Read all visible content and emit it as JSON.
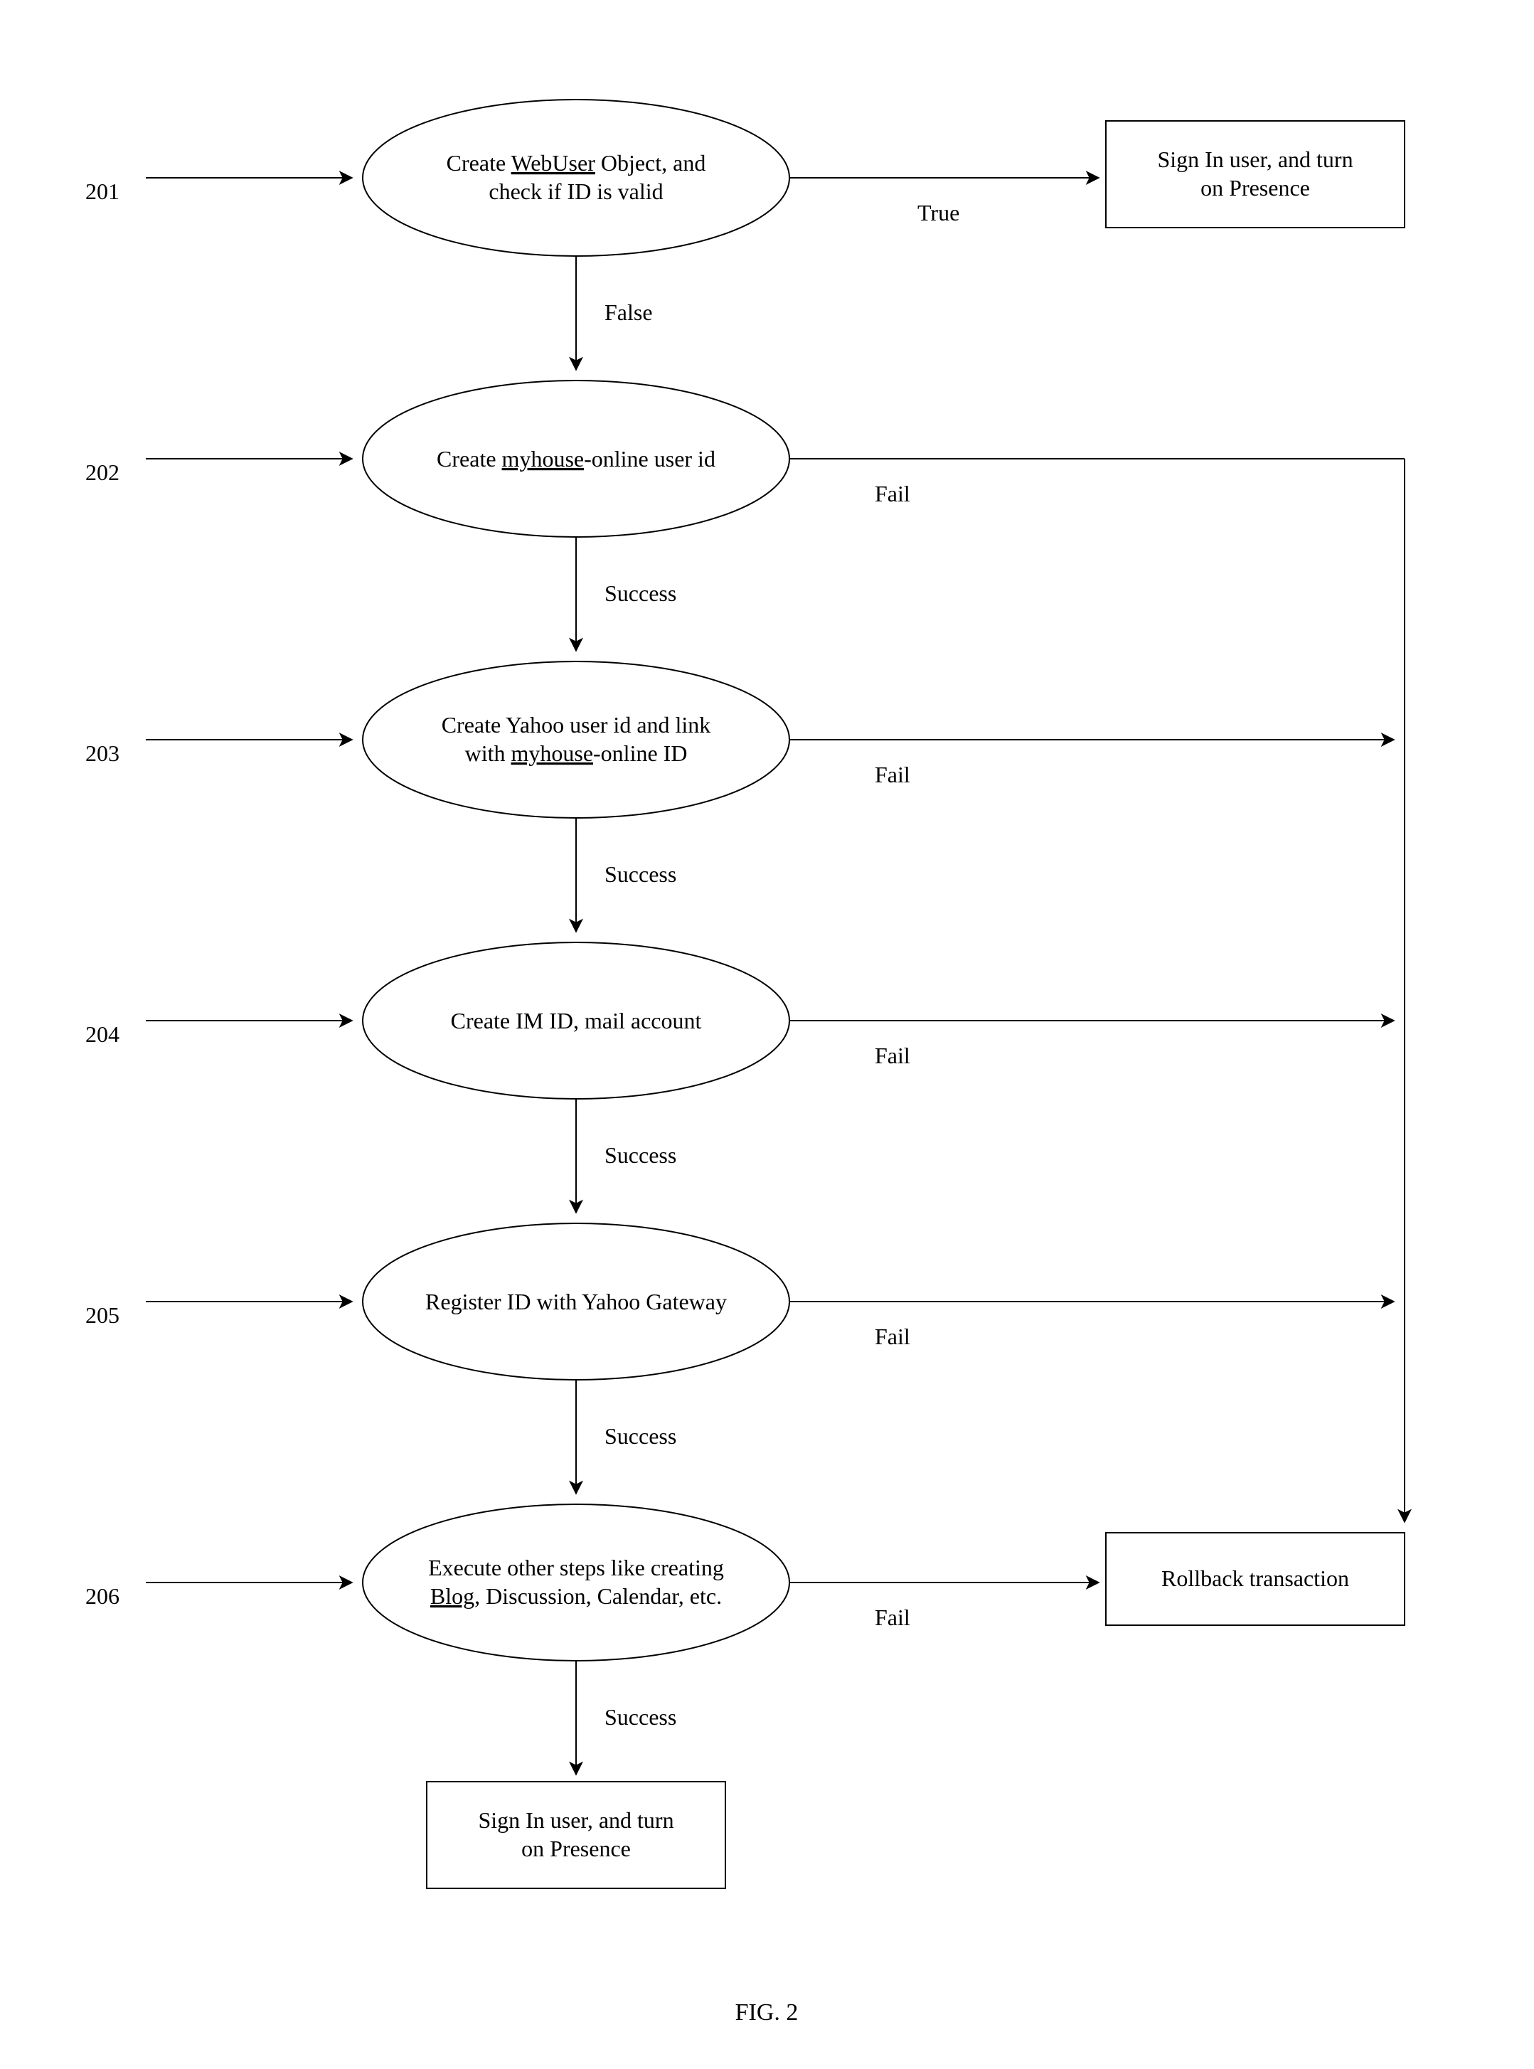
{
  "figure": {
    "caption": "FIG. 2"
  },
  "refs": {
    "r201": "201",
    "r202": "202",
    "r203": "203",
    "r204": "204",
    "r205": "205",
    "r206": "206"
  },
  "nodes": {
    "n1": {
      "l1a": "Create ",
      "l1b": "WebUser",
      "l1c": " Object, and",
      "l2": "check if ID is valid"
    },
    "n2": {
      "l1a": "Create ",
      "l1b": "myhouse",
      "l1c": "-online user id"
    },
    "n3": {
      "l1": "Create Yahoo user id and link",
      "l2a": "with ",
      "l2b": "myhouse",
      "l2c": "-online ID"
    },
    "n4": {
      "l1": "Create IM ID, mail account"
    },
    "n5": {
      "l1": "Register ID with Yahoo Gateway"
    },
    "n6": {
      "l1": "Execute other steps like creating",
      "l2a": "Blog",
      "l2b": ", Discussion, Calendar, etc."
    },
    "signin": {
      "l1": "Sign In user, and turn",
      "l2": "on Presence"
    },
    "rollback": {
      "l1": "Rollback transaction"
    }
  },
  "labels": {
    "true": "True",
    "false": "False",
    "success": "Success",
    "fail": "Fail"
  }
}
